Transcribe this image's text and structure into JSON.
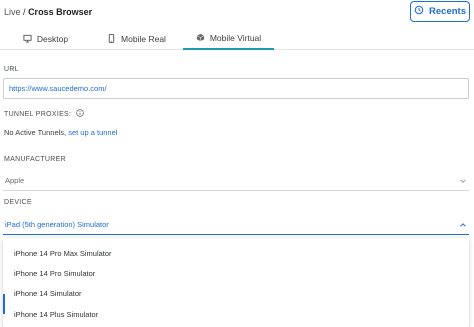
{
  "header": {
    "breadcrumb_root": "Live",
    "breadcrumb_sep": "/",
    "breadcrumb_current": "Cross Browser",
    "recents_label": "Recents"
  },
  "tabs": [
    {
      "label": "Desktop",
      "icon": "monitor-icon",
      "active": false
    },
    {
      "label": "Mobile Real",
      "icon": "smartphone-icon",
      "active": false
    },
    {
      "label": "Mobile Virtual",
      "icon": "cube-icon",
      "active": true
    }
  ],
  "url": {
    "label": "URL",
    "value": "https://www.saucedemo.com/"
  },
  "tunnel": {
    "label": "TUNNEL PROXIES:",
    "status_text": "No Active Tunnels,",
    "link_text": "set up a tunnel"
  },
  "manufacturer": {
    "label": "MANUFACTURER",
    "value": "Apple"
  },
  "device": {
    "label": "DEVICE",
    "value": "iPad (5th generation) Simulator",
    "options": [
      "iPhone 14 Pro Max Simulator",
      "iPhone 14 Pro Simulator",
      "iPhone 14 Simulator",
      "iPhone 14 Plus Simulator"
    ]
  },
  "colors": {
    "accent": "#1d6cdc",
    "tab_active": "#1d9bb0"
  }
}
